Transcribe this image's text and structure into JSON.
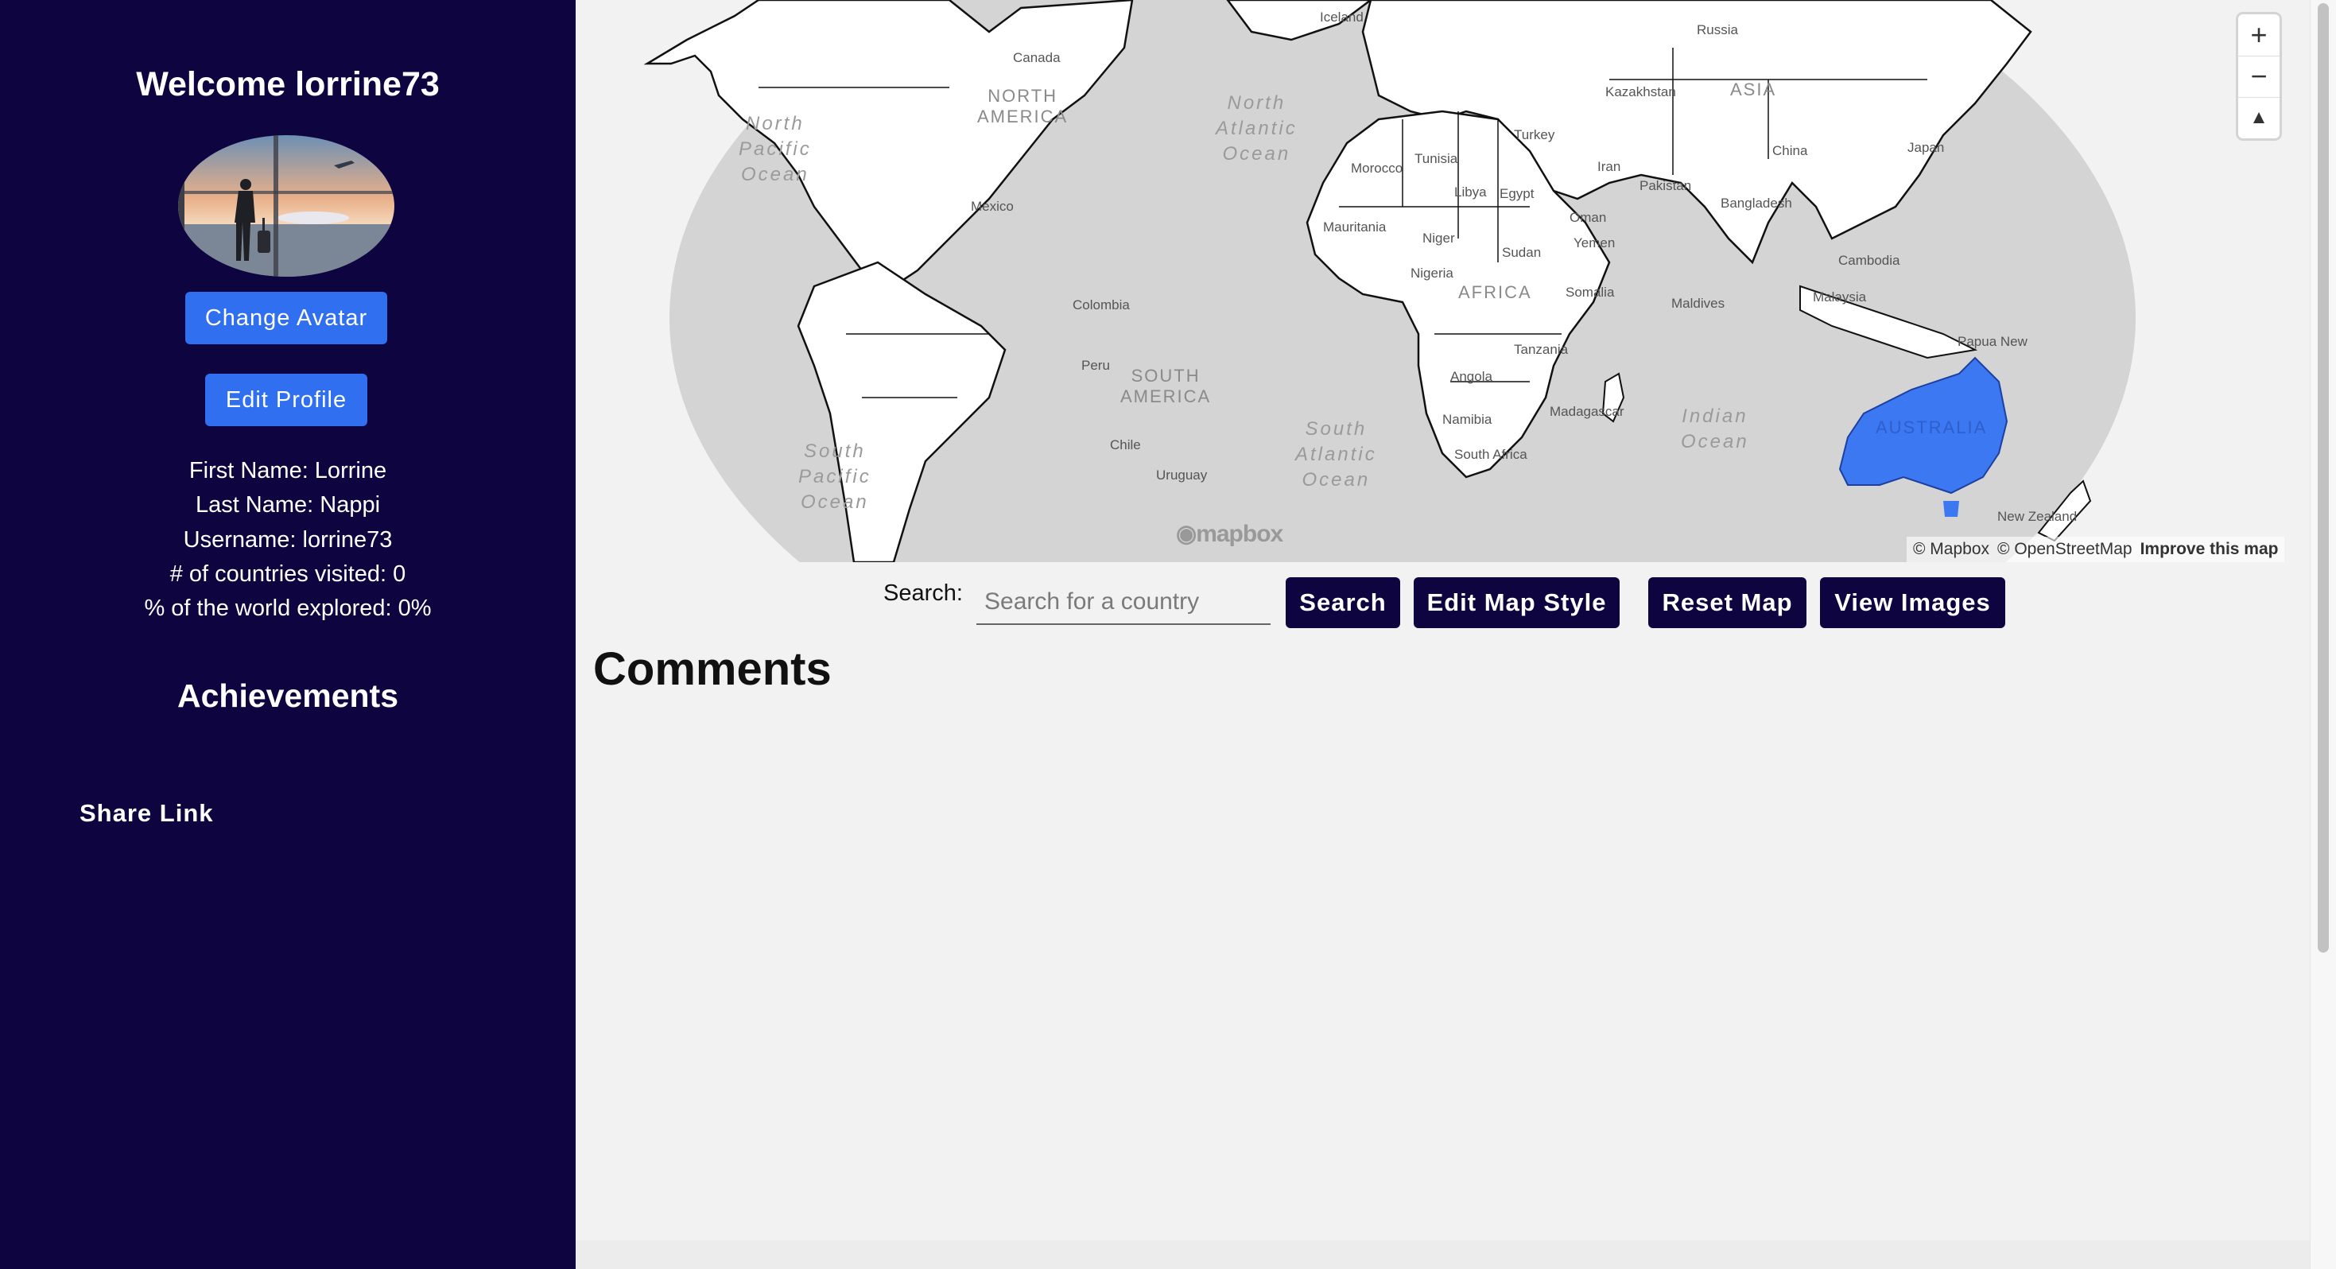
{
  "sidebar": {
    "welcome": "Welcome lorrine73",
    "change_avatar_label": "Change Avatar",
    "edit_profile_label": "Edit Profile",
    "profile": {
      "first_name": "First Name: Lorrine",
      "last_name": "Last Name: Nappi",
      "username": "Username: lorrine73",
      "countries_visited": "# of countries visited: 0",
      "world_explored": "% of the world explored: 0%"
    },
    "achievements_heading": "Achievements",
    "share_link_label": "Share Link"
  },
  "map": {
    "highlight_color": "#3b78f2",
    "continent_labels": {
      "north_america": "NORTH\nAMERICA",
      "south_america": "SOUTH\nAMERICA",
      "africa": "AFRICA",
      "asia": "ASIA",
      "australia": "AUSTRALIA"
    },
    "ocean_labels": {
      "north_pacific": "North\nPacific\nOcean",
      "north_atlantic": "North\nAtlantic\nOcean",
      "south_pacific": "South\nPacific\nOcean",
      "south_atlantic": "South\nAtlantic\nOcean",
      "indian": "Indian\nOcean"
    },
    "country_labels": {
      "canada": "Canada",
      "russia": "Russia",
      "kazakhstan": "Kazakhstan",
      "china": "China",
      "japan": "Japan",
      "iran": "Iran",
      "turkey": "Turkey",
      "libya": "Libya",
      "egypt": "Egypt",
      "sudan": "Sudan",
      "niger": "Niger",
      "nigeria": "Nigeria",
      "mauritania": "Mauritania",
      "morocco": "Morocco",
      "tunisia": "Tunisia",
      "mexico": "Mexico",
      "colombia": "Colombia",
      "peru": "Peru",
      "chile": "Chile",
      "uruguay": "Uruguay",
      "tanzania": "Tanzania",
      "angola": "Angola",
      "namibia": "Namibia",
      "south_africa": "South Africa",
      "madagascar": "Madagascar",
      "somalia": "Somalia",
      "yemen": "Yemen",
      "oman": "Oman",
      "pakistan": "Pakistan",
      "bangladesh": "Bangladesh",
      "maldives": "Maldives",
      "malaysia": "Malaysia",
      "cambodia": "Cambodia",
      "new_zealand": "New Zealand",
      "iceland": "Iceland",
      "papua_new_guinea": "Papua New"
    },
    "zoom_in": "+",
    "zoom_out": "−",
    "compass": "▲",
    "logo_text": "mapbox",
    "attribution_mapbox": "© Mapbox",
    "attribution_osm": "© OpenStreetMap",
    "attribution_improve": "Improve this map"
  },
  "search": {
    "label": "Search:",
    "placeholder": "Search for a country",
    "value": "",
    "search_button": "Search",
    "edit_style_button": "Edit Map Style",
    "reset_button": "Reset Map",
    "view_images_button": "View Images"
  },
  "comments": {
    "heading": "Comments"
  }
}
